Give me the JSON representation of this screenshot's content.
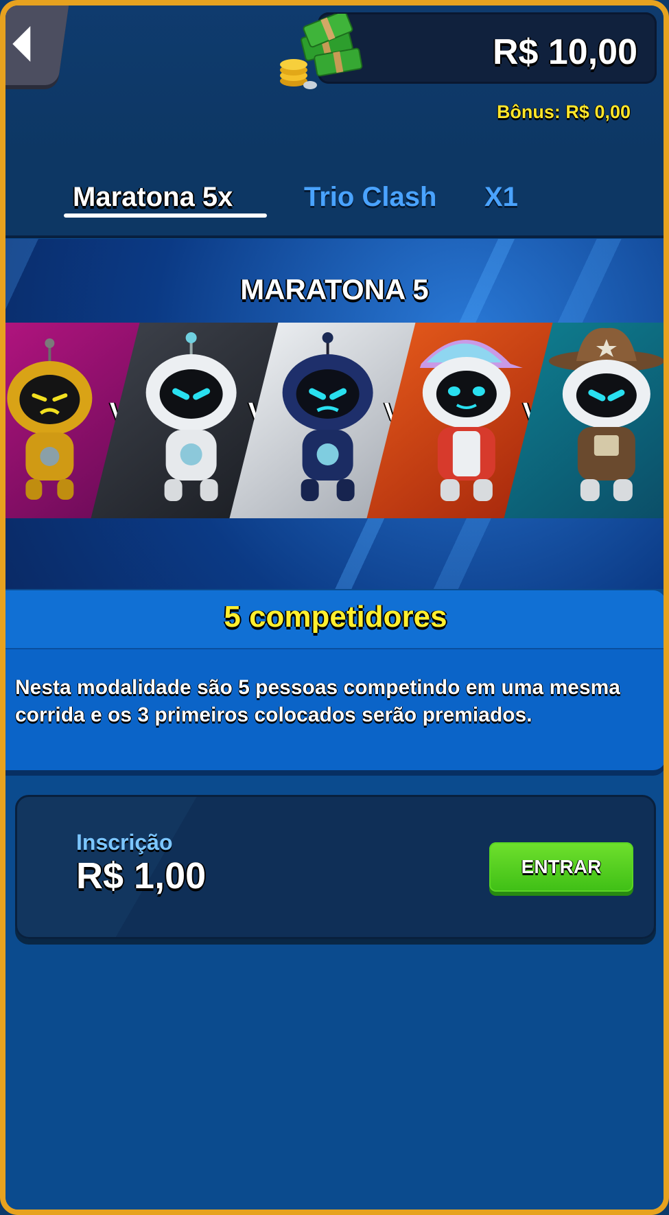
{
  "header": {
    "balance": "R$ 10,00",
    "bonus": "Bônus: R$ 0,00",
    "back_icon": "back-arrow-icon",
    "money_icon": "cash-stack-icon"
  },
  "tabs": [
    {
      "label": "Maratona 5x",
      "active": true
    },
    {
      "label": "Trio Clash",
      "active": false
    },
    {
      "label": "X1",
      "active": false
    }
  ],
  "banner": {
    "title": "MARATONA 5",
    "vs_label": "VS",
    "competitors": [
      "yellow-robot",
      "white-robot",
      "navy-robot",
      "cap-robot",
      "cowboy-robot"
    ]
  },
  "info": {
    "title": "5 competidores",
    "description": "Nesta modalidade são 5 pessoas competindo em uma mesma corrida e os 3 primeiros colocados serão premiados."
  },
  "entry": {
    "label": "Inscrição",
    "price": "R$ 1,00",
    "button_label": "ENTRAR"
  },
  "colors": {
    "frame": "#e7a21f",
    "tab_inactive": "#4aa3ff",
    "highlight_yellow": "#ffef2e",
    "button_green": "#4fcf1d"
  }
}
